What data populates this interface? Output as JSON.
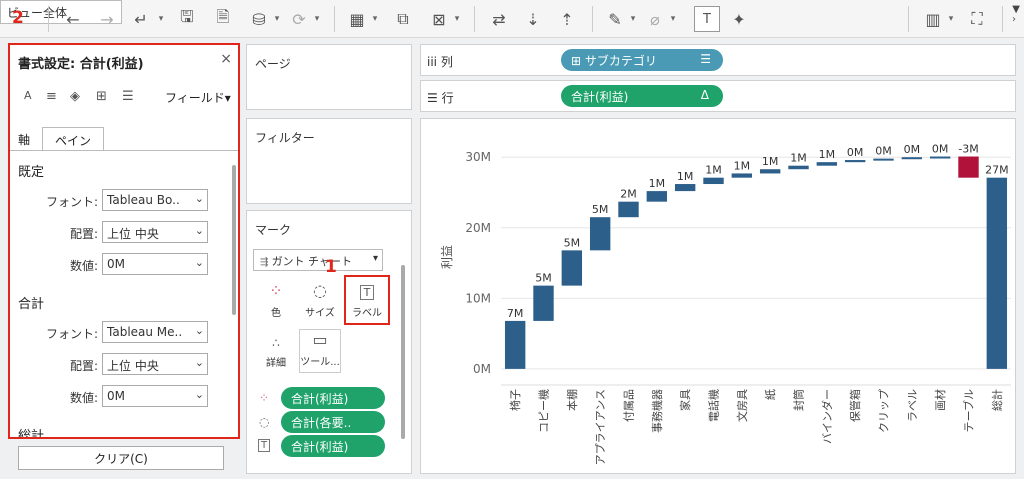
{
  "annotations": {
    "label_1": "1",
    "label_2": "2"
  },
  "toolbar": {
    "view_select": "ビュー全体"
  },
  "format_pane": {
    "title": "書式設定: 合計(利益)",
    "close": "×",
    "field_label": "フィールド▾",
    "tabs": [
      {
        "label": "軸"
      },
      {
        "label": "ペイン"
      }
    ],
    "sections": [
      {
        "title": "既定",
        "rows": [
          {
            "label": "フォント:",
            "value": "Tableau Bo.."
          },
          {
            "label": "配置:",
            "value": "上位 中央"
          },
          {
            "label": "数値:",
            "value": "0M"
          }
        ]
      },
      {
        "title": "合計",
        "rows": [
          {
            "label": "フォント:",
            "value": "Tableau Me.."
          },
          {
            "label": "配置:",
            "value": "上位 中央"
          },
          {
            "label": "数値:",
            "value": "0M"
          }
        ]
      },
      {
        "title": "総計",
        "rows": []
      }
    ],
    "clear_button": "クリア(C)"
  },
  "panels": {
    "pages": "ページ",
    "filters": "フィルター",
    "marks": "マーク"
  },
  "marks": {
    "mark_type": "ガント チャート",
    "buttons": [
      {
        "label": "色"
      },
      {
        "label": "サイズ"
      },
      {
        "label": "ラベル"
      },
      {
        "label": "詳細"
      },
      {
        "label": "ツール..."
      }
    ],
    "pills": [
      {
        "text": "合計(利益)"
      },
      {
        "text": "合計(各要.."
      },
      {
        "text": "合計(利益)"
      }
    ]
  },
  "shelves": {
    "columns": {
      "label": "列",
      "pill": "サブカテゴリ",
      "pill_icon": "⊞"
    },
    "rows": {
      "label": "行",
      "pill": "合計(利益)",
      "pill_icon": "Δ"
    }
  },
  "colors": {
    "positive": "#2d5f8b",
    "negative": "#b0123a",
    "accent_red": "#e0261b",
    "pill_green": "#1fa36b",
    "pill_blue": "#4a9ab5"
  },
  "chart_data": {
    "type": "bar",
    "subtype": "waterfall",
    "ylabel": "利益",
    "ylim": [
      -2,
      34
    ],
    "yticks": [
      {
        "v": 0,
        "label": "0M"
      },
      {
        "v": 10,
        "label": "10M"
      },
      {
        "v": 20,
        "label": "20M"
      },
      {
        "v": 30,
        "label": "30M"
      }
    ],
    "categories": [
      "椅子",
      "コピー機",
      "本棚",
      "アプライアンス",
      "付属品",
      "事務機器",
      "家具",
      "電話機",
      "文房具",
      "紙",
      "封筒",
      "バインダー",
      "保管箱",
      "クリップ",
      "ラベル",
      "画材",
      "テーブル",
      "総計"
    ],
    "values": [
      6.8,
      5.0,
      5.0,
      4.7,
      2.2,
      1.5,
      1.0,
      0.9,
      0.6,
      0.6,
      0.5,
      0.5,
      0.3,
      0.2,
      0.2,
      0.1,
      -3.0,
      27.1
    ],
    "data_labels": [
      "7M",
      "5M",
      "5M",
      "5M",
      "2M",
      "1M",
      "1M",
      "1M",
      "1M",
      "1M",
      "1M",
      "1M",
      "0M",
      "0M",
      "0M",
      "0M",
      "-3M",
      "27M"
    ],
    "total_index": 17
  }
}
